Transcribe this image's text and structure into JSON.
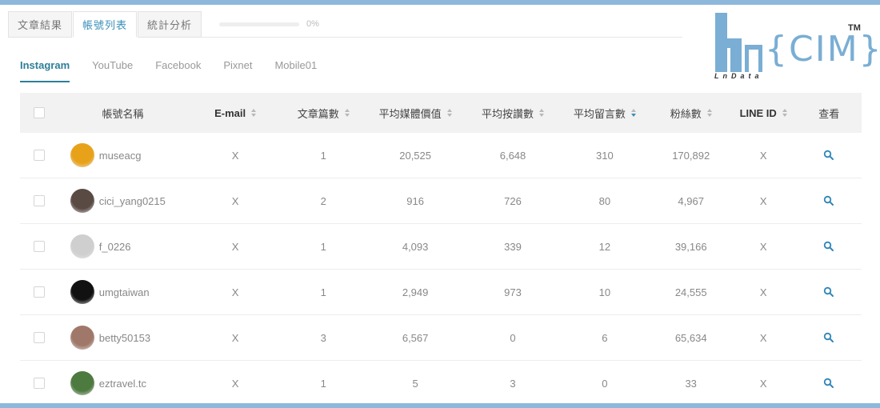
{
  "top_tabs": [
    {
      "label": "文章結果",
      "active": false
    },
    {
      "label": "帳號列表",
      "active": true
    },
    {
      "label": "統計分析",
      "active": false
    }
  ],
  "progress": {
    "value": 0,
    "text": "0%"
  },
  "platform_tabs": [
    {
      "label": "Instagram",
      "active": true
    },
    {
      "label": "YouTube",
      "active": false
    },
    {
      "label": "Facebook",
      "active": false
    },
    {
      "label": "Pixnet",
      "active": false
    },
    {
      "label": "Mobile01",
      "active": false
    }
  ],
  "logo": {
    "brand": "CIM",
    "sub": "LnData",
    "tm": "TM",
    "color": "#7aaed4"
  },
  "table": {
    "headers": {
      "name": "帳號名稱",
      "email": "E-mail",
      "posts": "文章篇數",
      "media_value": "平均媒體價值",
      "likes": "平均按讚數",
      "comments": "平均留言數",
      "fans": "粉絲數",
      "line_id": "LINE ID",
      "view": "查看"
    },
    "sorted_column": "comments",
    "rows": [
      {
        "account": "museacg",
        "email": "X",
        "posts": "1",
        "media_value": "20,525",
        "likes": "6,648",
        "comments": "310",
        "fans": "170,892",
        "line_id": "X",
        "avatar_color": "#e8a21a"
      },
      {
        "account": "cici_yang0215",
        "email": "X",
        "posts": "2",
        "media_value": "916",
        "likes": "726",
        "comments": "80",
        "fans": "4,967",
        "line_id": "X",
        "avatar_color": "#5a4a44"
      },
      {
        "account": "f_0226",
        "email": "X",
        "posts": "1",
        "media_value": "4,093",
        "likes": "339",
        "comments": "12",
        "fans": "39,166",
        "line_id": "X",
        "avatar_color": "#cfcfcf"
      },
      {
        "account": "umgtaiwan",
        "email": "X",
        "posts": "1",
        "media_value": "2,949",
        "likes": "973",
        "comments": "10",
        "fans": "24,555",
        "line_id": "X",
        "avatar_color": "#111111"
      },
      {
        "account": "betty50153",
        "email": "X",
        "posts": "3",
        "media_value": "6,567",
        "likes": "0",
        "comments": "6",
        "fans": "65,634",
        "line_id": "X",
        "avatar_color": "#a0786a"
      },
      {
        "account": "eztravel.tc",
        "email": "X",
        "posts": "1",
        "media_value": "5",
        "likes": "3",
        "comments": "0",
        "fans": "33",
        "line_id": "X",
        "avatar_color": "#4d7a3e"
      }
    ]
  },
  "colors": {
    "accent": "#3a8fb8",
    "frame": "#8db8dc"
  }
}
